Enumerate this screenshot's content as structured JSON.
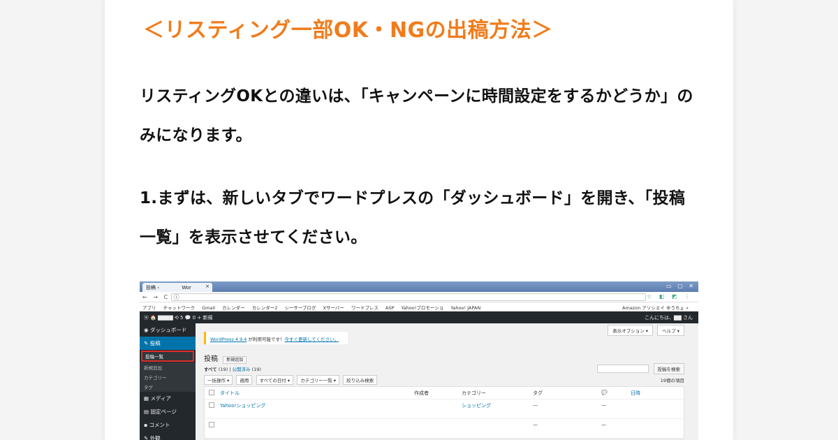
{
  "article": {
    "heading": "＜リスティング一部OK・NGの出稿方法＞",
    "para1": "リスティングOKとの違いは、「キャンペーンに時間設定をするかどうか」のみになります。",
    "para2": "1.まずは、新しいタブでワードプレスの「ダッシュボード」を開き、「投稿一覧」を表示させてください。"
  },
  "screenshot": {
    "browser": {
      "tab_title": "投稿 ‹",
      "tab_site": "Wor",
      "tab_close": "×",
      "nav": "← → C ⓘ",
      "bookmarks": [
        "アプリ",
        "チャットワーク",
        "Gmail",
        "カレンダー",
        "カレンダー2",
        "シーサーブログ",
        "Xサーバー",
        "ワードプレス",
        "ASP",
        "Yahoo!プロモーショ",
        "Yahoo! JAPAN"
      ],
      "bookmarks_right": "Amazon アソシエイ  ゆうちょ  »"
    },
    "adminbar": {
      "left": "ⓦ  🏠 ▇▇▇▇  ⟲ 5  💬 0  + 新規",
      "greeting": "こんにちは、▇▇ さん"
    },
    "sidebar": {
      "dashboard": "ダッシュボード",
      "posts": "投稿",
      "sub_all": "投稿一覧",
      "sub_new": "新規追加",
      "sub_cat": "カテゴリー",
      "sub_tag": "タグ",
      "media": "メディア",
      "pages": "固定ページ",
      "comments": "コメント",
      "appearance": "外観"
    },
    "main": {
      "notice_link": "WordPress 4.9.4",
      "notice_mid": " が利用可能です！",
      "notice_update": "今すぐ更新してください。",
      "screen_options": "表示オプション ▾",
      "help": "ヘルプ ▾",
      "title": "投稿",
      "add_new": "新規追加",
      "filter_all": "すべて",
      "filter_all_count": "(19)",
      "filter_sep": " | ",
      "filter_pub": "公開済み",
      "filter_pub_count": "(19)",
      "search_button": "投稿を検索",
      "bulk_action": "一括操作 ▾",
      "apply": "適用",
      "all_dates": "すべての日付 ▾",
      "all_categories": "カテゴリー一覧 ▾",
      "filter_button": "絞り込み検索",
      "items_count": "19個の項目",
      "columns": {
        "title": "タイトル",
        "author": "作成者",
        "category": "カテゴリー",
        "tags": "タグ",
        "comments": "💬",
        "date": "日時"
      },
      "rows": [
        {
          "title": "Yahoo!ショッピング",
          "category": "ショッピング",
          "tags": "—",
          "comments": "—"
        },
        {
          "title": "",
          "category": "",
          "tags": "—",
          "comments": "—"
        }
      ]
    }
  }
}
